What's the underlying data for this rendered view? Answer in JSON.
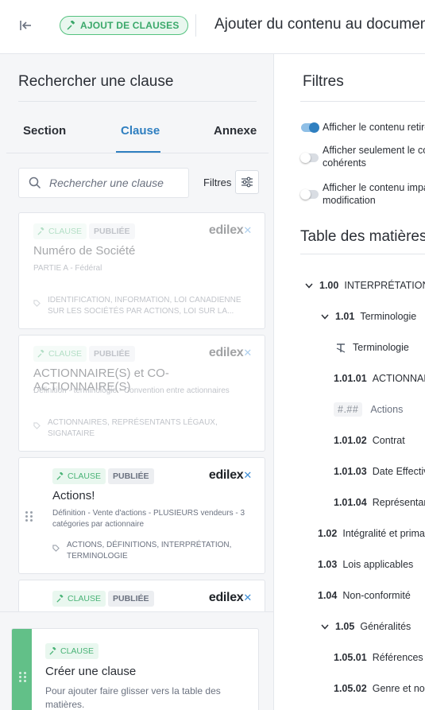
{
  "topbar": {
    "mode_badge": "AJOUT DE CLAUSES",
    "title": "Ajouter du contenu au document"
  },
  "left_panel": {
    "title": "Rechercher une clause",
    "tabs": [
      {
        "label": "Section",
        "active": false
      },
      {
        "label": "Clause",
        "active": true
      },
      {
        "label": "Annexe",
        "active": false
      }
    ],
    "search": {
      "placeholder": "Rechercher une clause",
      "value": ""
    },
    "filters_label": "Filtres",
    "cards": [
      {
        "tag": "CLAUSE",
        "status": "PUBLIÉE",
        "brand": "edilex",
        "title": "Numéro de Société",
        "description": "PARTIE A - Fédéral",
        "keywords": "IDENTIFICATION, INFORMATION, LOI CANADIENNE SUR LES SOCIÉTÉS PAR ACTIONS, LOI SUR LA...",
        "faded": true
      },
      {
        "tag": "CLAUSE",
        "status": "PUBLIÉE",
        "brand": "edilex",
        "title": "ACTIONNAIRE(S) et CO-ACTIONNAIRE(S)",
        "description": "Définition - terminologie - Convention entre actionnaires",
        "keywords": "ACTIONNAIRES, REPRÉSENTANTS LÉGAUX, SIGNATAIRE",
        "faded": true
      },
      {
        "tag": "CLAUSE",
        "status": "PUBLIÉE",
        "brand": "edilex",
        "title": "Actions!",
        "description": "Définition - Vente d'actions - PLUSIEURS vendeurs - 3 catégories par actionnaire",
        "keywords": "ACTIONS, DÉFINITIONS, INTERPRÉTATION, TERMINOLOGIE",
        "faded": false
      },
      {
        "tag": "CLAUSE",
        "status": "PUBLIÉE",
        "brand": "edilex"
      }
    ],
    "create": {
      "tag": "CLAUSE",
      "title": "Créer une clause",
      "hint": "Pour ajouter faire glisser vers la table des matières."
    }
  },
  "right_panel": {
    "title": "Filtres",
    "options": [
      {
        "label_lines": [
          "Afficher le contenu retiré"
        ],
        "on": true
      },
      {
        "label_lines": [
          "Afficher seulement le contenu",
          "cohérents"
        ],
        "on": false
      },
      {
        "label_lines": [
          "Afficher le contenu impacté par la",
          "modification"
        ],
        "on": false
      }
    ],
    "toc_title": "Table des matières",
    "toc": [
      {
        "num": "1.00",
        "label": "INTERPRÉTATION",
        "chevron": "down"
      },
      {
        "num": "1.01",
        "label": "Terminologie",
        "chevron": "down"
      },
      {
        "num": "",
        "label": "Terminologie",
        "icon": "text-style-icon"
      },
      {
        "num": "1.01.01",
        "label": "ACTIONNAIRE(S)"
      },
      {
        "num": "",
        "label": "Actions",
        "placeholder": "#.##"
      },
      {
        "num": "1.01.02",
        "label": "Contrat"
      },
      {
        "num": "1.01.03",
        "label": "Date Effective"
      },
      {
        "num": "1.01.04",
        "label": "Représentants"
      },
      {
        "num": "1.02",
        "label": "Intégralité et primauté"
      },
      {
        "num": "1.03",
        "label": "Lois applicables"
      },
      {
        "num": "1.04",
        "label": "Non-conformité"
      },
      {
        "num": "1.05",
        "label": "Généralités",
        "chevron": "down"
      },
      {
        "num": "1.05.01",
        "label": "Références fiscales"
      },
      {
        "num": "1.05.02",
        "label": "Genre et nombre"
      }
    ]
  },
  "colors": {
    "accent_blue": "#2f7fc0",
    "clause_green": "#49b376",
    "create_strip_green": "#62c088",
    "panel_bg": "#f5f6f8"
  }
}
